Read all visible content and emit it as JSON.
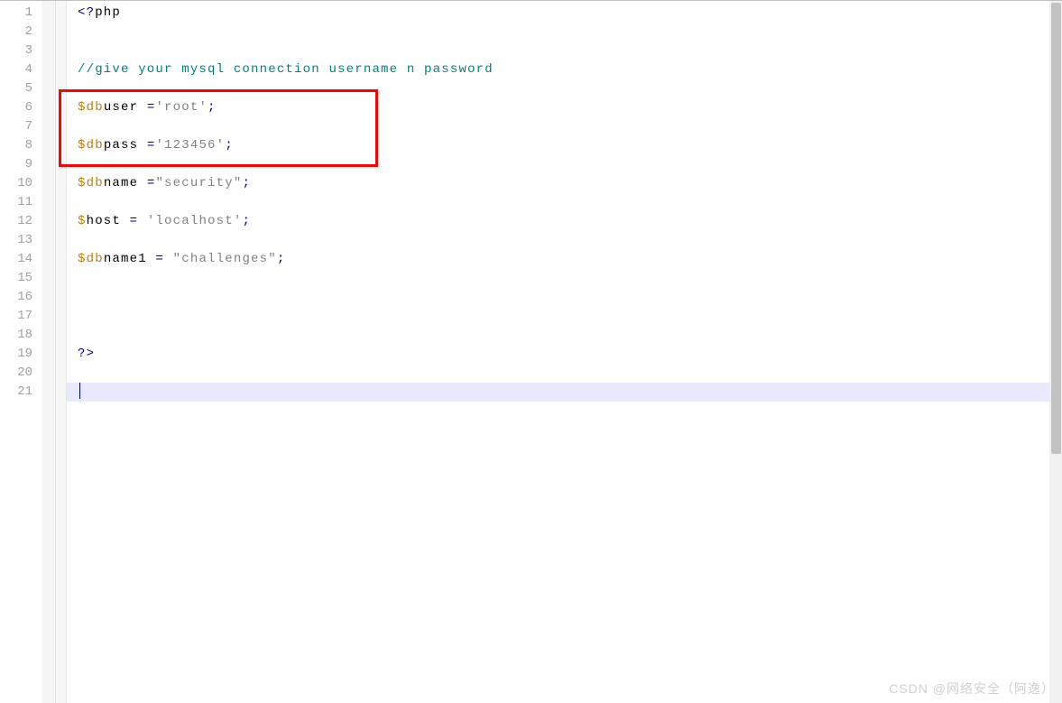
{
  "editor": {
    "line_count": 21,
    "current_line_index": 20,
    "lines": [
      {
        "n": 1,
        "tokens": [
          {
            "t": "<?",
            "c": "tok-tag"
          },
          {
            "t": "php",
            "c": "tok-var"
          }
        ]
      },
      {
        "n": 2,
        "tokens": []
      },
      {
        "n": 3,
        "tokens": []
      },
      {
        "n": 4,
        "tokens": [
          {
            "t": "//give your mysql connection username n password",
            "c": "tok-comment"
          }
        ]
      },
      {
        "n": 5,
        "tokens": []
      },
      {
        "n": 6,
        "tokens": [
          {
            "t": "$db",
            "c": "tok-keyword"
          },
          {
            "t": "user ",
            "c": "tok-var"
          },
          {
            "t": "=",
            "c": "tok-op"
          },
          {
            "t": "'root'",
            "c": "tok-string"
          },
          {
            "t": ";",
            "c": "tok-punct"
          }
        ]
      },
      {
        "n": 7,
        "tokens": []
      },
      {
        "n": 8,
        "tokens": [
          {
            "t": "$db",
            "c": "tok-keyword"
          },
          {
            "t": "pass ",
            "c": "tok-var"
          },
          {
            "t": "=",
            "c": "tok-op"
          },
          {
            "t": "'123456'",
            "c": "tok-string"
          },
          {
            "t": ";",
            "c": "tok-punct"
          }
        ]
      },
      {
        "n": 9,
        "tokens": []
      },
      {
        "n": 10,
        "tokens": [
          {
            "t": "$db",
            "c": "tok-keyword"
          },
          {
            "t": "name ",
            "c": "tok-var"
          },
          {
            "t": "=",
            "c": "tok-op"
          },
          {
            "t": "\"security\"",
            "c": "tok-string"
          },
          {
            "t": ";",
            "c": "tok-punct"
          }
        ]
      },
      {
        "n": 11,
        "tokens": []
      },
      {
        "n": 12,
        "tokens": [
          {
            "t": "$",
            "c": "tok-keyword"
          },
          {
            "t": "host ",
            "c": "tok-var"
          },
          {
            "t": "=",
            "c": "tok-op"
          },
          {
            "t": " ",
            "c": "tok-var"
          },
          {
            "t": "'localhost'",
            "c": "tok-string"
          },
          {
            "t": ";",
            "c": "tok-punct"
          }
        ]
      },
      {
        "n": 13,
        "tokens": []
      },
      {
        "n": 14,
        "tokens": [
          {
            "t": "$db",
            "c": "tok-keyword"
          },
          {
            "t": "name1 ",
            "c": "tok-var"
          },
          {
            "t": "=",
            "c": "tok-op"
          },
          {
            "t": " ",
            "c": "tok-var"
          },
          {
            "t": "\"challenges\"",
            "c": "tok-string"
          },
          {
            "t": ";",
            "c": "tok-punct"
          }
        ]
      },
      {
        "n": 15,
        "tokens": []
      },
      {
        "n": 16,
        "tokens": []
      },
      {
        "n": 17,
        "tokens": []
      },
      {
        "n": 18,
        "tokens": []
      },
      {
        "n": 19,
        "tokens": [
          {
            "t": "?>",
            "c": "tok-tag"
          }
        ]
      },
      {
        "n": 20,
        "tokens": []
      },
      {
        "n": 21,
        "tokens": []
      }
    ]
  },
  "highlight": {
    "present": true
  },
  "watermark": "CSDN @网络安全（阿逸）"
}
